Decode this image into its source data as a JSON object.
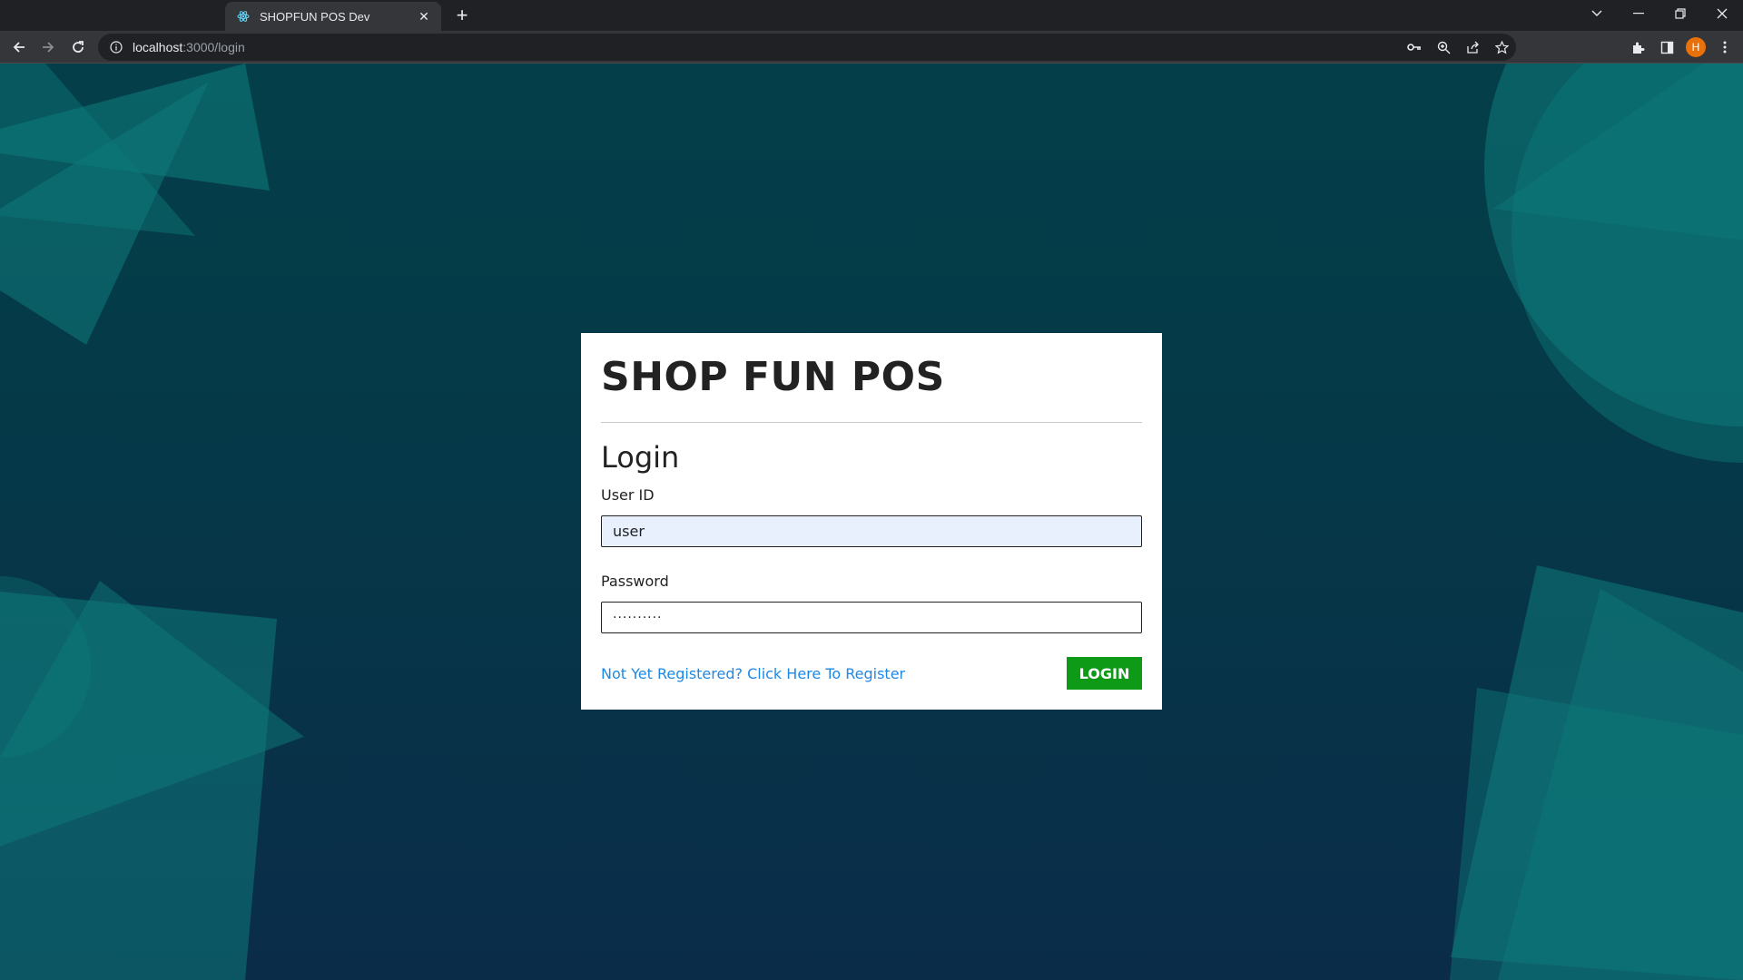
{
  "browser": {
    "tab_title": "SHOPFUN POS Dev",
    "url_host": "localhost",
    "url_path": ":3000/login",
    "profile_initial": "H"
  },
  "app": {
    "brand": "SHOP FUN POS",
    "heading": "Login",
    "user_id": {
      "label": "User ID",
      "value": "user"
    },
    "password": {
      "label": "Password",
      "value": "··········"
    },
    "register_link": "Not Yet Registered? Click Here To Register",
    "login_button": "LOGIN"
  },
  "colors": {
    "background": "#053848",
    "shape": "#0e7a7a",
    "login_button": "#0e9a17",
    "link": "#1e88e5"
  }
}
